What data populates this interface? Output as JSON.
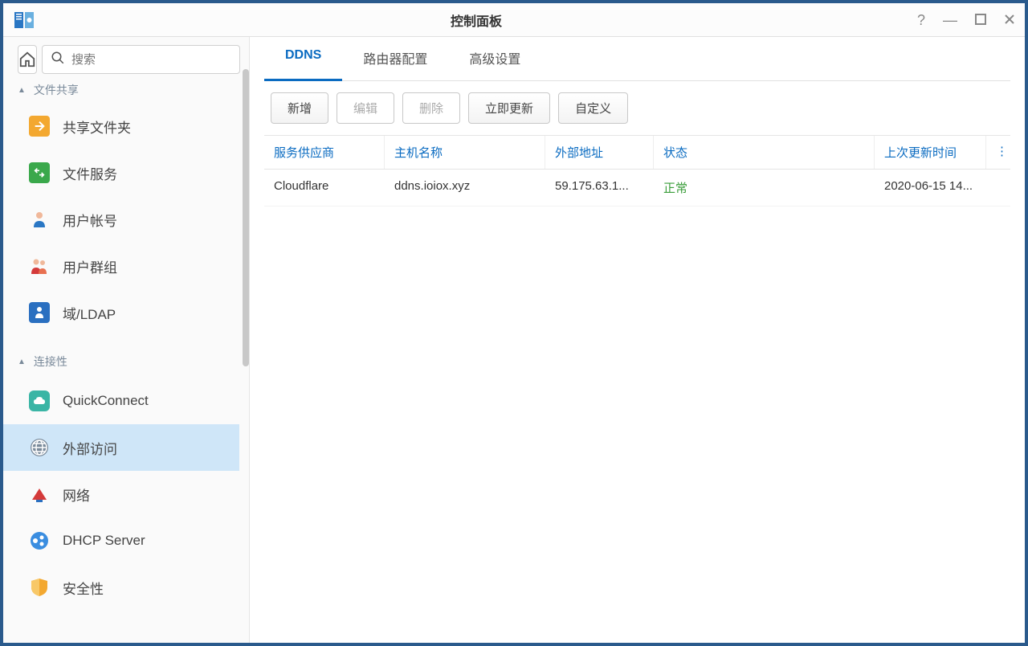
{
  "window": {
    "title": "控制面板"
  },
  "search": {
    "placeholder": "搜索"
  },
  "sidebar": {
    "section_fileshare": "文件共享",
    "section_connectivity": "连接性",
    "items": {
      "shared_folder": "共享文件夹",
      "file_service": "文件服务",
      "user_account": "用户帐号",
      "user_group": "用户群组",
      "domain_ldap": "域/LDAP",
      "quickconnect": "QuickConnect",
      "external_access": "外部访问",
      "network": "网络",
      "dhcp": "DHCP Server",
      "security": "安全性"
    }
  },
  "tabs": {
    "ddns": "DDNS",
    "router": "路由器配置",
    "advanced": "高级设置"
  },
  "toolbar": {
    "add": "新增",
    "edit": "编辑",
    "delete": "删除",
    "update_now": "立即更新",
    "custom": "自定义"
  },
  "table": {
    "headers": {
      "provider": "服务供应商",
      "hostname": "主机名称",
      "external": "外部地址",
      "status": "状态",
      "updated": "上次更新时间"
    },
    "rows": [
      {
        "provider": "Cloudflare",
        "hostname": "ddns.ioiox.xyz",
        "external": "59.175.63.1...",
        "status": "正常",
        "updated": "2020-06-15 14..."
      }
    ]
  }
}
